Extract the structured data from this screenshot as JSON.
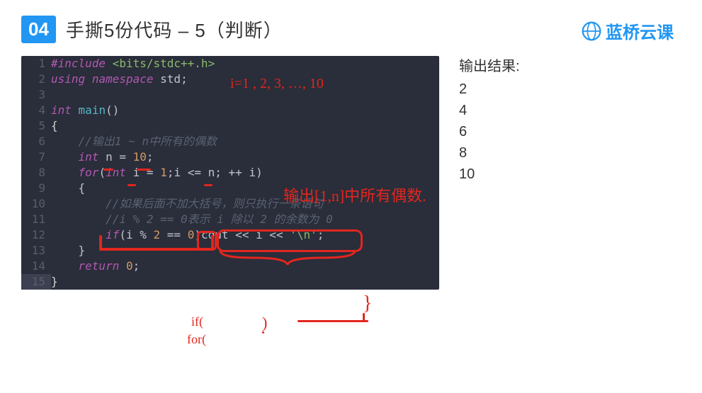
{
  "header": {
    "badge": "04",
    "title": "手撕5份代码 – 5（判断）"
  },
  "logo": {
    "text": "蓝桥云课"
  },
  "code": {
    "lines": [
      {
        "n": "1",
        "html": "<span class='c-pp'>#include</span> <span class='c-inc'>&lt;bits/stdc++.h&gt;</span>"
      },
      {
        "n": "2",
        "html": "<span class='c-kw'>using</span> <span class='c-kw'>namespace</span> <span class='c-id'>std</span>;"
      },
      {
        "n": "3",
        "html": ""
      },
      {
        "n": "4",
        "html": "<span class='c-type'>int</span> <span class='c-fn'>main</span>()"
      },
      {
        "n": "5",
        "html": "<span class='c-br'>{</span>"
      },
      {
        "n": "6",
        "html": "    <span class='c-cmt'>//输出1 ~ n中所有的偶数</span>"
      },
      {
        "n": "7",
        "html": "    <span class='c-type'>int</span> <span class='c-id'>n</span> = <span class='c-num'>10</span>;"
      },
      {
        "n": "8",
        "html": "    <span class='c-kw'>for</span>(<span class='c-type'>int</span> <span class='c-id'>i</span> = <span class='c-num'>1</span>;<span class='c-id'>i</span> &lt;= <span class='c-id'>n</span>; ++ <span class='c-id'>i</span>)"
      },
      {
        "n": "9",
        "html": "    {"
      },
      {
        "n": "10",
        "html": "        <span class='c-cmt'>//如果后面不加大括号，则只执行一条语句</span>"
      },
      {
        "n": "11",
        "html": "        <span class='c-cmt'>//i % 2 == 0表示 i 除以 2 的余数为 0</span>"
      },
      {
        "n": "12",
        "html": "        <span class='c-kw'>if</span>(<span class='c-id'>i</span> % <span class='c-num'>2</span> == <span class='c-num'>0</span>)<span class='c-id'>cout</span> &lt;&lt; <span class='c-id'>i</span> &lt;&lt; <span class='c-str'>'\\n'</span>;"
      },
      {
        "n": "13",
        "html": "    }"
      },
      {
        "n": "14",
        "html": "    <span class='c-kw'>return</span> <span class='c-num'>0</span>;"
      },
      {
        "n": "15",
        "html": "<span class='c-br'>}</span>"
      }
    ]
  },
  "output": {
    "title": "输出结果:",
    "lines": [
      "2",
      "4",
      "6",
      "8",
      "10"
    ]
  },
  "annotations": {
    "top": "i=1 , 2, 3, …, 10",
    "right": "输出[1,n]中所有偶数.",
    "bottom_if": "if(",
    "bottom_for": "for(",
    "bottom_br": ")",
    "bottom_close": "}"
  }
}
